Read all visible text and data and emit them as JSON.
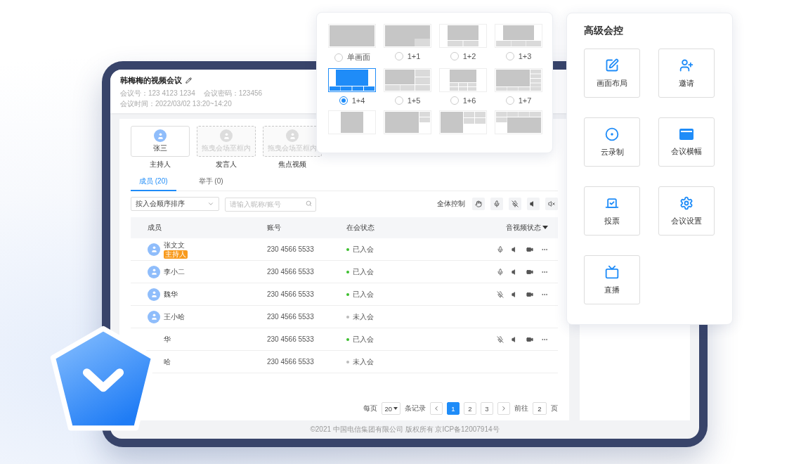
{
  "meeting": {
    "title": "韩梅梅的视频会议",
    "info": [
      "会议号：123 4123 1234",
      "会议密码：123456",
      "会议时间：2022/03/02 13:20~14:20"
    ]
  },
  "seats": [
    {
      "kind": "filled",
      "name": "张三",
      "label": "主持人"
    },
    {
      "kind": "empty",
      "hint": "拖曳会场至框内",
      "label": "发言人"
    },
    {
      "kind": "empty",
      "hint": "拖曳会场至框内",
      "label": "焦点视频"
    }
  ],
  "tabs": [
    {
      "label": "成员 (20)",
      "selected": true
    },
    {
      "label": "举手 (0)",
      "selected": false
    }
  ],
  "toolbar": {
    "sort": "按入会顺序排序",
    "search_placeholder": "请输入昵称/账号",
    "all_control": "全体控制"
  },
  "table": {
    "columns": [
      "成员",
      "账号",
      "在会状态",
      "音视频状态"
    ],
    "rows": [
      {
        "name": "张文文",
        "tag": "主持人",
        "avatar": true,
        "account": "230 4566 5533",
        "status": "已入会",
        "joined": true,
        "mic_muted": false
      },
      {
        "name": "李小二",
        "avatar": true,
        "account": "230 4566 5533",
        "status": "已入会",
        "joined": true,
        "mic_muted": false
      },
      {
        "name": "魏华",
        "avatar": true,
        "account": "230 4566 5533",
        "status": "已入会",
        "joined": true,
        "mic_muted": true
      },
      {
        "name": "王小哈",
        "avatar": true,
        "account": "230 4566 5533",
        "status": "未入会",
        "joined": false
      },
      {
        "name": "华",
        "avatar": false,
        "account": "230 4566 5533",
        "status": "已入会",
        "joined": true,
        "mic_muted": true
      },
      {
        "name": "哈",
        "avatar": false,
        "account": "230 4566 5533",
        "status": "未入会",
        "joined": false
      }
    ]
  },
  "pagination": {
    "per_page_label": "每页",
    "per_page": "20",
    "records_label": "条记录",
    "pages": [
      {
        "label": "1",
        "selected": true
      },
      {
        "label": "2",
        "selected": false
      },
      {
        "label": "3",
        "selected": false
      }
    ],
    "goto_label": "前往",
    "goto_value": "2",
    "page_label": "页"
  },
  "footer": "©2021 中国电信集团有限公司 版权所有 京ICP备12007914号",
  "layout_popup": {
    "options": [
      {
        "kind": "single",
        "label": "单画面",
        "selected": false
      },
      {
        "kind": "pip",
        "label": "1+1",
        "selected": false
      },
      {
        "kind": "bottom2",
        "label": "1+2",
        "selected": false
      },
      {
        "kind": "bottom3",
        "label": "1+3",
        "selected": false
      },
      {
        "kind": "bottom4",
        "label": "1+4",
        "selected": true
      },
      {
        "kind": "side5",
        "label": "1+5",
        "selected": false
      },
      {
        "kind": "grid6",
        "label": "1+6",
        "selected": false
      },
      {
        "kind": "side7",
        "label": "1+7",
        "selected": false
      }
    ],
    "more": [
      {
        "kind": "center"
      },
      {
        "kind": "side"
      },
      {
        "kind": "quad"
      },
      {
        "kind": "rows"
      }
    ]
  },
  "control_panel": {
    "title": "高级会控",
    "items": [
      {
        "kind": "layout",
        "label": "画面布局"
      },
      {
        "kind": "invite",
        "label": "邀请"
      },
      {
        "kind": "record",
        "label": "云录制"
      },
      {
        "kind": "banner",
        "label": "会议横幅"
      },
      {
        "kind": "vote",
        "label": "投票"
      },
      {
        "kind": "settings",
        "label": "会议设置"
      },
      {
        "kind": "live",
        "label": "直播"
      }
    ]
  }
}
